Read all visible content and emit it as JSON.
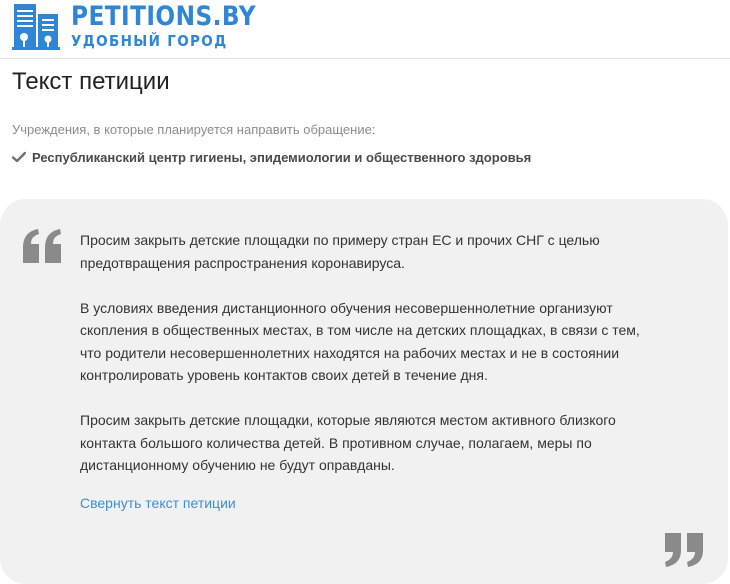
{
  "header": {
    "logo_title": "PETITIONS.BY",
    "logo_subtitle": "УДОБНЫЙ ГОРОД"
  },
  "page": {
    "title": "Текст петиции"
  },
  "institutions": {
    "label": "Учреждения, в которые планируется направить обращение:",
    "items": [
      {
        "icon": "check-icon",
        "name": "Республиканский центр гигиены, эпидемиологии и общественного здоровья"
      }
    ]
  },
  "petition": {
    "paragraphs": [
      "Просим закрыть детские площадки по примеру стран ЕС и прочих СНГ с целью предотвращения распространения коронавируса.",
      "В условиях введения дистанционного обучения несовершеннолетние организуют скопления в общественных местах, в том числе на детских площадках, в связи с тем, что родители несовершеннолетних находятся на рабочих местах и не в состоянии контролировать уровень контактов своих детей в течение дня.",
      "Просим закрыть детские площадки, которые являются местом активного близкого контакта большого количества детей. В противном случае, полагаем, меры по дистанционному обучению не будут оправданы."
    ],
    "collapse_link": "Свернуть текст петиции"
  },
  "colors": {
    "brand_blue": "#2f86d6",
    "link_blue": "#3a8fd6",
    "quote_background": "#f1f1f1",
    "quote_mark": "#8a8a8a"
  }
}
